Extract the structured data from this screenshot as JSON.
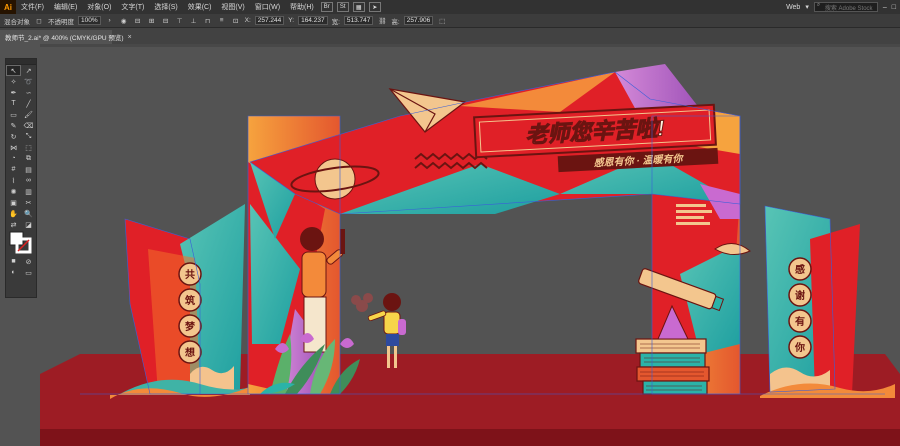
{
  "app": {
    "logo": "Ai"
  },
  "menubar": {
    "items": [
      "文件(F)",
      "编辑(E)",
      "对象(O)",
      "文字(T)",
      "选择(S)",
      "效果(C)",
      "视图(V)",
      "窗口(W)",
      "帮助(H)"
    ],
    "mode_label": "Br",
    "stock_label": "St",
    "workspace": "Web",
    "search_placeholder": "搜索 Adobe Stock"
  },
  "controlbar": {
    "group_label": "混合对象",
    "opacity_label": "不透明度",
    "opacity_value": "100%",
    "x_label": "X:",
    "x_value": "257.244",
    "y_label": "Y:",
    "y_value": "164.237",
    "w_label": "宽:",
    "w_value": "513.747",
    "h_label": "高:",
    "h_value": "257.906"
  },
  "document": {
    "tab_label": "教师节_2.ai* @ 400% (CMYK/GPU 预览)",
    "close": "×"
  },
  "artwork": {
    "banner_title": "老师您辛苦啦!",
    "banner_subtitle": "感恩有你 · 温暖有你",
    "left_flag_chars": [
      "共",
      "筑",
      "梦",
      "想"
    ],
    "right_flag_chars": [
      "感",
      "谢",
      "有",
      "你"
    ],
    "colors": {
      "stage": "#9d1c24",
      "arch_red": "#e02027",
      "arch_orange": "#f38a3a",
      "teal": "#2bb3a8",
      "purple": "#c06fc8",
      "cream": "#f5d6a8"
    }
  }
}
